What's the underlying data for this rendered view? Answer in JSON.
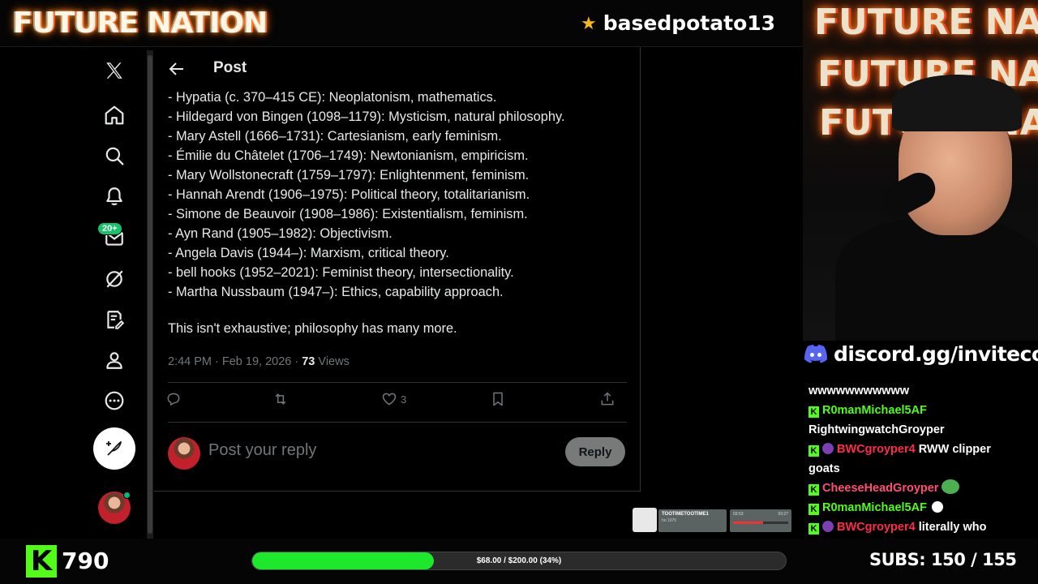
{
  "overlay": {
    "brand": "FUTURE NATION",
    "streamer_name": "basedpotato13",
    "discord": "discord.gg/invitecode",
    "webcam_neon": [
      "FUTURE NATION",
      "FUTURE NATION",
      "FUTURE NATION"
    ],
    "kick_followers": "790",
    "goal": {
      "label": "$68.00 / $200.00 (34%)",
      "progress": 0.34
    },
    "subs": "SUBS:  150 / 155",
    "mini_player": {
      "title": "TOOTIMETOOTIME1",
      "subtitle": "ho 1975",
      "time_start": "03:53",
      "time_end": "03:27"
    },
    "colors": {
      "kick_green": "#53fc18",
      "goal_fill": "#1ee82c",
      "neon_orange": "#ff8a2a"
    }
  },
  "nav": {
    "items": [
      "x-logo-icon",
      "home-icon",
      "search-icon",
      "notifications-icon",
      "messages-icon",
      "grok-icon",
      "articles-icon",
      "profile-icon",
      "more-icon"
    ],
    "messages_badge": "20+",
    "compose": "compose-post-icon"
  },
  "post": {
    "header_title": "Post",
    "lines": [
      "- Hypatia (c. 370–415 CE): Neoplatonism, mathematics.",
      "- Hildegard von Bingen (1098–1179): Mysticism, natural philosophy.",
      "- Mary Astell (1666–1731): Cartesianism, early feminism.",
      "- Émilie du Châtelet (1706–1749): Newtonianism, empiricism.",
      "- Mary Wollstonecraft (1759–1797): Enlightenment, feminism.",
      "- Hannah Arendt (1906–1975): Political theory, totalitarianism.",
      "- Simone de Beauvoir (1908–1986): Existentialism, feminism.",
      "- Ayn Rand (1905–1982): Objectivism.",
      "- Angela Davis (1944–): Marxism, critical theory.",
      "- bell hooks (1952–2021): Feminist theory, intersectionality.",
      "- Martha Nussbaum (1947–): Ethics, capability approach."
    ],
    "closing": "This isn't exhaustive; philosophy has many more.",
    "meta_time": "2:44 PM · Feb 19, 2026 · ",
    "views_count": "73",
    "views_label": " Views",
    "likes": "3",
    "reply_placeholder": "Post your reply",
    "reply_button": "Reply"
  },
  "chat": {
    "messages": [
      {
        "user": "",
        "text": "wwwwwwwwwww"
      },
      {
        "user": "R0manMichael5AF",
        "text": ""
      },
      {
        "user": "",
        "text": "RightwingwatchGroyper"
      },
      {
        "user": "BWCgroyper4",
        "text": " RWW clipper"
      },
      {
        "user": "",
        "text": "goats"
      },
      {
        "user": "CheeseHeadGroyper",
        "text": ""
      },
      {
        "user": "R0manMichael5AF",
        "text": ""
      },
      {
        "user": "BWCgroyper4",
        "text": " literally who"
      }
    ]
  }
}
